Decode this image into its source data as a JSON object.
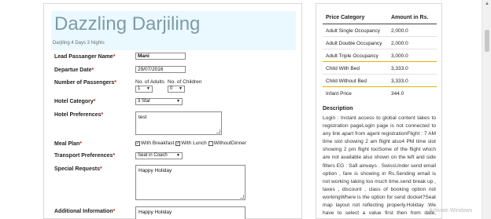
{
  "header": {
    "title": "Dazzling Darjiling",
    "subtitle": "Darjiling 4 Days 3 Nights"
  },
  "form": {
    "lead_name": {
      "label": "Lead Passanger Name",
      "req": "*",
      "value": "Mani"
    },
    "departure": {
      "label": "Departue Date",
      "req": "*",
      "value": "29/07/2016"
    },
    "passengers": {
      "label": "Number of Passengers",
      "req": "*",
      "adults_label": "No. of Adults",
      "adults_value": "1",
      "children_label": "No. of Children",
      "children_value": "0"
    },
    "hotel_category": {
      "label": "Hotel Category",
      "req": "*",
      "value": "3 Star"
    },
    "hotel_prefs": {
      "label": "Hotel Preferences",
      "req": "*",
      "value": "test"
    },
    "meal_plan": {
      "label": "Meal Plan",
      "req": "*",
      "opt1": "With Breakfast",
      "opt2": "With Lunch",
      "opt3": "WithoutDinner"
    },
    "transport": {
      "label": "Transport Preferences",
      "req": "*",
      "value": "Seat in Coach"
    },
    "special": {
      "label": "Special Requests",
      "req": "*",
      "value": "Happy Holiday"
    },
    "additional": {
      "label": "Additional Information",
      "req": "*",
      "value": "Happy Holiday"
    }
  },
  "prices": {
    "head_category": "Price Category",
    "head_amount": "Amount in Rs.",
    "rows": [
      {
        "cat": "Adult Single Occupancy",
        "amt": "2,000.0"
      },
      {
        "cat": "Adult Double Occupancy",
        "amt": "2,000.0"
      },
      {
        "cat": "Adult Triple Occupancy",
        "amt": "3,000.0"
      },
      {
        "cat": "Child With Bed",
        "amt": "3,333.0"
      },
      {
        "cat": "Child Without Bed",
        "amt": "3,333.0"
      },
      {
        "cat": "Infant Price",
        "amt": "344.0"
      }
    ]
  },
  "description": {
    "title": "Description",
    "text": "Login : Instant access to global content takes to registration pageLogin page is not connected to any link apart from agent registrationFlight : 7 AM time slot showing 2 am flight also4 PM time slot showing 2 pm flight tooSome of the flight which are not available also shown on the left and side filters EG : Safi airways . SwissUnder send email option , fare is showing in Rs.Sending email is not working taking too much time.send break up , taxes , discount , class of booking option not workingWhere is the option for send docket?Seat map layout not reflecting properly.Holiday :We have to select a value first then from date, otherwise its not working"
  },
  "watermark": "Activate Windows",
  "icons": {
    "chevron": "chevron-down-icon",
    "check": "check-icon",
    "scroll-up": "scroll-up-arrow-icon"
  }
}
